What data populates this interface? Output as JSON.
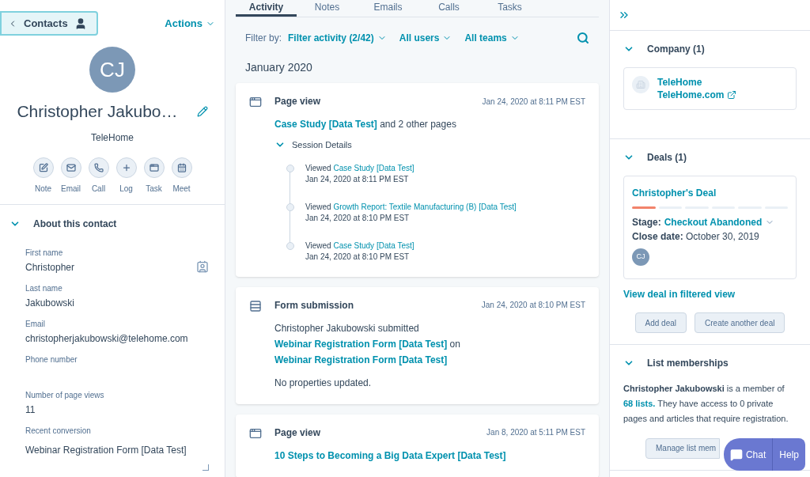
{
  "contact_panel": {
    "back_button": "Contacts",
    "actions": "Actions",
    "avatar_initials": "CJ",
    "name": "Christopher Jakubo…",
    "company": "TeleHome",
    "quick_actions": [
      {
        "label": "Note",
        "kind": "note"
      },
      {
        "label": "Email",
        "kind": "email"
      },
      {
        "label": "Call",
        "kind": "call"
      },
      {
        "label": "Log",
        "kind": "log"
      },
      {
        "label": "Task",
        "kind": "task"
      },
      {
        "label": "Meet",
        "kind": "meet"
      }
    ],
    "about": {
      "title": "About this contact",
      "expanded": true,
      "fields": [
        {
          "label": "First name",
          "value": "Christopher",
          "kind": "name"
        },
        {
          "label": "Last name",
          "value": "Jakubowski",
          "kind": "text"
        },
        {
          "label": "Email",
          "value": "christopherjakubowski@telehome.com",
          "kind": "text"
        },
        {
          "label": "Phone number",
          "kind": "text"
        },
        {
          "label": "Number of page views",
          "value": "11",
          "kind": "text"
        },
        {
          "label": "Recent conversion",
          "value": "Webinar Registration Form [Data Test]",
          "kind": "textarea"
        }
      ]
    }
  },
  "activity_panel": {
    "tabs": [
      {
        "label": "Activity",
        "selected": true
      },
      {
        "label": "Notes",
        "selected": false
      },
      {
        "label": "Emails",
        "selected": false
      },
      {
        "label": "Calls",
        "selected": false
      },
      {
        "label": "Tasks",
        "selected": false
      }
    ],
    "filter_label": "Filter by:",
    "filters": [
      "Filter activity (2/42)",
      "All users",
      "All teams"
    ],
    "month": "January 2020",
    "activities": [
      {
        "kind": "page_view",
        "title": "Page view",
        "time": "Jan 24, 2020 at 8:11 PM EST",
        "summary": [
          {
            "text": "Case Study [Data Test]",
            "kind": "link"
          },
          {
            "text": " and 2 other pages",
            "kind": "text"
          }
        ],
        "session": {
          "title": "Session Details",
          "expanded": true,
          "entries": [
            {
              "prefix": "Viewed",
              "link": "Case Study [Data Test]",
              "time": "Jan 24, 2020 at 8:11 PM EST"
            },
            {
              "prefix": "Viewed",
              "link": "Growth Report: Textile Manufacturing (B) [Data Test]",
              "time": "Jan 24, 2020 at 8:10 PM EST"
            },
            {
              "prefix": "Viewed",
              "link": "Case Study [Data Test]",
              "time": "Jan 24, 2020 at 8:10 PM EST"
            }
          ]
        }
      },
      {
        "kind": "form_submission",
        "title": "Form submission",
        "time": "Jan 24, 2020 at 8:10 PM EST",
        "summary": [
          {
            "text": "Christopher Jakubowski submitted ",
            "kind": "text"
          },
          {
            "text": "Webinar Registration Form [Data Test]",
            "kind": "link"
          },
          {
            "text": " on ",
            "kind": "text"
          },
          {
            "text": "Webinar Registration Form [Data Test]",
            "kind": "link"
          }
        ],
        "note": "No properties updated."
      },
      {
        "kind": "page_view",
        "title": "Page view",
        "time": "Jan 8, 2020 at 5:11 PM EST",
        "summary": [
          {
            "text": "10 Steps to Becoming a Big Data Expert [Data Test]",
            "kind": "link"
          }
        ]
      }
    ]
  },
  "sidebar": {
    "sections": [
      {
        "kind": "company",
        "title": "Company (1)",
        "expanded": true,
        "company": {
          "name": "TeleHome",
          "domain": "TeleHome.com"
        }
      },
      {
        "kind": "deals",
        "title": "Deals (1)",
        "expanded": true,
        "deal": {
          "name": "Christopher's Deal",
          "level": 0.1667,
          "stage_label": "Stage:",
          "stage": "Checkout Abandoned",
          "close_label": "Close date:",
          "close_date": "October 30, 2019",
          "owner_initials": "CJ"
        },
        "link": "View deal in filtered view",
        "buttons": [
          "Add deal",
          "Create another deal"
        ]
      },
      {
        "kind": "lists",
        "title": "List memberships",
        "expanded": true,
        "text": [
          {
            "text": "Christopher Jakubowski",
            "kind": "bold"
          },
          {
            "text": " is a member of ",
            "kind": "text"
          },
          {
            "text": "68 lists.",
            "kind": "link"
          },
          {
            "text": " They have access to 0 private pages and articles that require registration.",
            "kind": "text"
          }
        ],
        "button": "Manage list mem"
      }
    ]
  },
  "chat_widget": {
    "chat": "Chat",
    "help": "Help"
  }
}
